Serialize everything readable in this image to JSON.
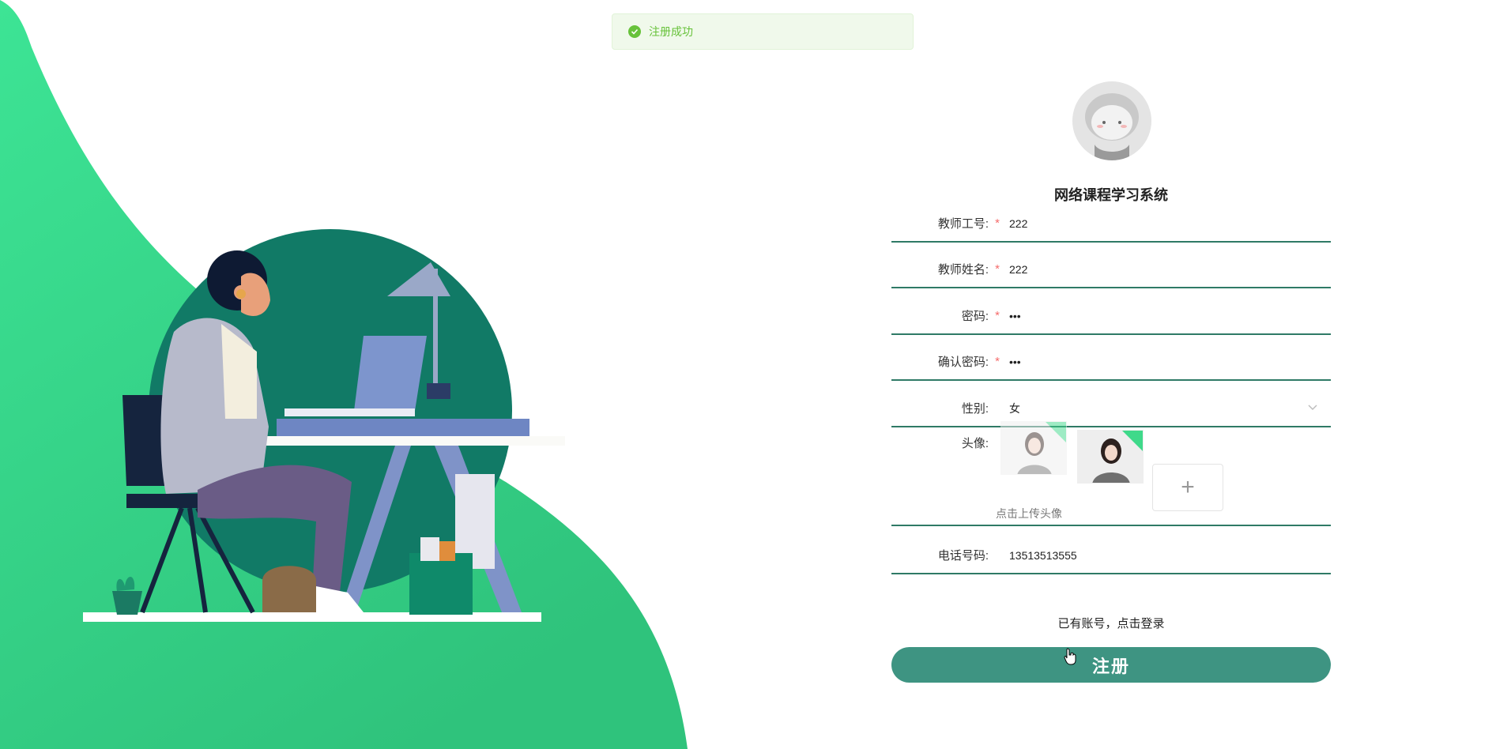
{
  "toast": {
    "icon": "success-check-icon",
    "text": "注册成功",
    "color": "#67c23a"
  },
  "header": {
    "title": "网络课程学习系统"
  },
  "form": {
    "teacher_id": {
      "label": "教师工号:",
      "required": "*",
      "value": "222"
    },
    "teacher_name": {
      "label": "教师姓名:",
      "required": "*",
      "value": "222"
    },
    "password": {
      "label": "密码:",
      "required": "*",
      "value": "•••"
    },
    "confirm_password": {
      "label": "确认密码:",
      "required": "*",
      "value": "•••"
    },
    "gender": {
      "label": "性别:",
      "value": "女"
    },
    "avatar": {
      "label": "头像:",
      "upload_hint": "点击上传头像",
      "add_glyph": "+"
    },
    "phone": {
      "label": "电话号码:",
      "value": "13513513555"
    }
  },
  "actions": {
    "login_link": "已有账号，点击登录",
    "submit_label": "注册"
  },
  "colors": {
    "accent": "#2f7a66",
    "button": "#3e9482",
    "bg_green": "#34c983",
    "required": "#f56c6c"
  }
}
